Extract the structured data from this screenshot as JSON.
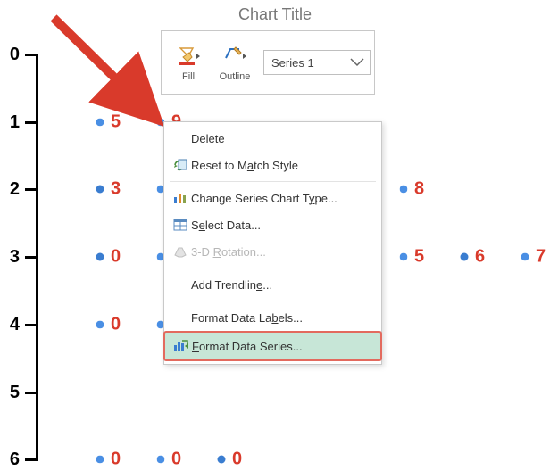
{
  "chart": {
    "title": "Chart Title",
    "y_ticks": [
      "0",
      "1",
      "2",
      "3",
      "4",
      "5",
      "6"
    ]
  },
  "chart_data": {
    "type": "scatter",
    "title": "Chart Title",
    "xlabel": "",
    "ylabel": "",
    "ylim": [
      0,
      6
    ],
    "series": [
      {
        "name": "Series 1",
        "points": [
          {
            "y": 1,
            "x": 1,
            "label": "5",
            "selected": true
          },
          {
            "y": 1,
            "x": 2,
            "label": "9",
            "selected": true
          },
          {
            "y": 2,
            "x": 1,
            "label": "3",
            "selected": false
          },
          {
            "y": 2,
            "x": 2,
            "label": "",
            "selected": true
          },
          {
            "y": 2,
            "x": 6,
            "label": "8",
            "selected": true
          },
          {
            "y": 3,
            "x": 1,
            "label": "0",
            "selected": false
          },
          {
            "y": 3,
            "x": 2,
            "label": "",
            "selected": true
          },
          {
            "y": 3,
            "x": 6,
            "label": "5",
            "selected": true
          },
          {
            "y": 3,
            "x": 7,
            "label": "6",
            "selected": false
          },
          {
            "y": 3,
            "x": 8,
            "label": "7",
            "selected": true
          },
          {
            "y": 4,
            "x": 1,
            "label": "0",
            "selected": true
          },
          {
            "y": 4,
            "x": 2,
            "label": "",
            "selected": true
          },
          {
            "y": 6,
            "x": 1,
            "label": "0",
            "selected": true
          },
          {
            "y": 6,
            "x": 2,
            "label": "0",
            "selected": true
          },
          {
            "y": 6,
            "x": 3,
            "label": "0",
            "selected": false
          }
        ]
      }
    ]
  },
  "toolbar": {
    "fill_label": "Fill",
    "outline_label": "Outline",
    "series_selected": "Series 1"
  },
  "menu": {
    "delete": "Delete",
    "reset": "Reset to Match Style",
    "change_type": "Change Series Chart Type...",
    "select_data": "Select Data...",
    "rotation": "3-D Rotation...",
    "trendline": "Add Trendline...",
    "format_labels": "Format Data Labels...",
    "format_series": "Format Data Series..."
  }
}
